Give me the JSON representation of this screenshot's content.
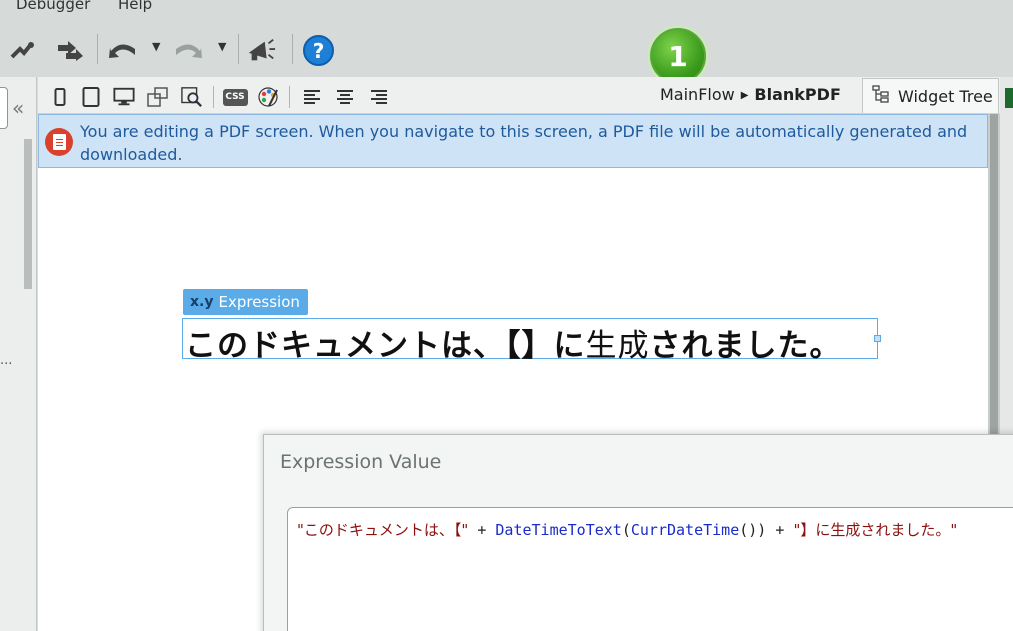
{
  "menu": {
    "items": [
      "Debugger",
      "Help"
    ]
  },
  "toolbar": {
    "icons": [
      "publish-icon",
      "merge-icon",
      "undo-icon",
      "redo-icon",
      "announce-icon",
      "help-icon"
    ],
    "help_label": "?",
    "badge_number": "1"
  },
  "canvas_toolbar": {
    "icons": [
      "phone-icon",
      "tablet-icon",
      "desktop-icon",
      "layout-icon",
      "preview-icon",
      "css-icon",
      "theme-icon",
      "align-left-icon",
      "align-center-icon",
      "align-right-icon"
    ],
    "css_label": "CSS"
  },
  "breadcrumb": {
    "flow": "MainFlow",
    "screen": "BlankPDF"
  },
  "widget_tree": {
    "label": "Widget Tree"
  },
  "banner": {
    "message": "You are editing a PDF screen. When you navigate to this screen, a PDF file will be automatically generated and downloaded."
  },
  "expression_widget": {
    "tag_icon": "x.y",
    "tag_label": "Expression",
    "text_bold_1": "このドキュメントは、【】に",
    "text_light": "生成",
    "text_bold_2": "されました。"
  },
  "dialog": {
    "title": "Expression Value",
    "code": {
      "str1": "\"このドキュメントは、【\"",
      "plus1": " + ",
      "fn1": "DateTimeToText",
      "paren_open": "(",
      "fn2": "CurrDateTime",
      "paren_close": "())",
      "plus2": " + ",
      "str2": "\"】に生成されました。\""
    }
  },
  "left_panel": {
    "collapse_label": "«",
    "ellipsis": "..."
  },
  "colors": {
    "banner_bg": "#cfe3f7",
    "banner_text": "#1e5a9c",
    "expression_tag": "#5aabe8",
    "badge_green": "#3a9a1b",
    "help_blue": "#1e7fd6",
    "string_red": "#8b1010",
    "function_blue": "#1a2cc8"
  }
}
